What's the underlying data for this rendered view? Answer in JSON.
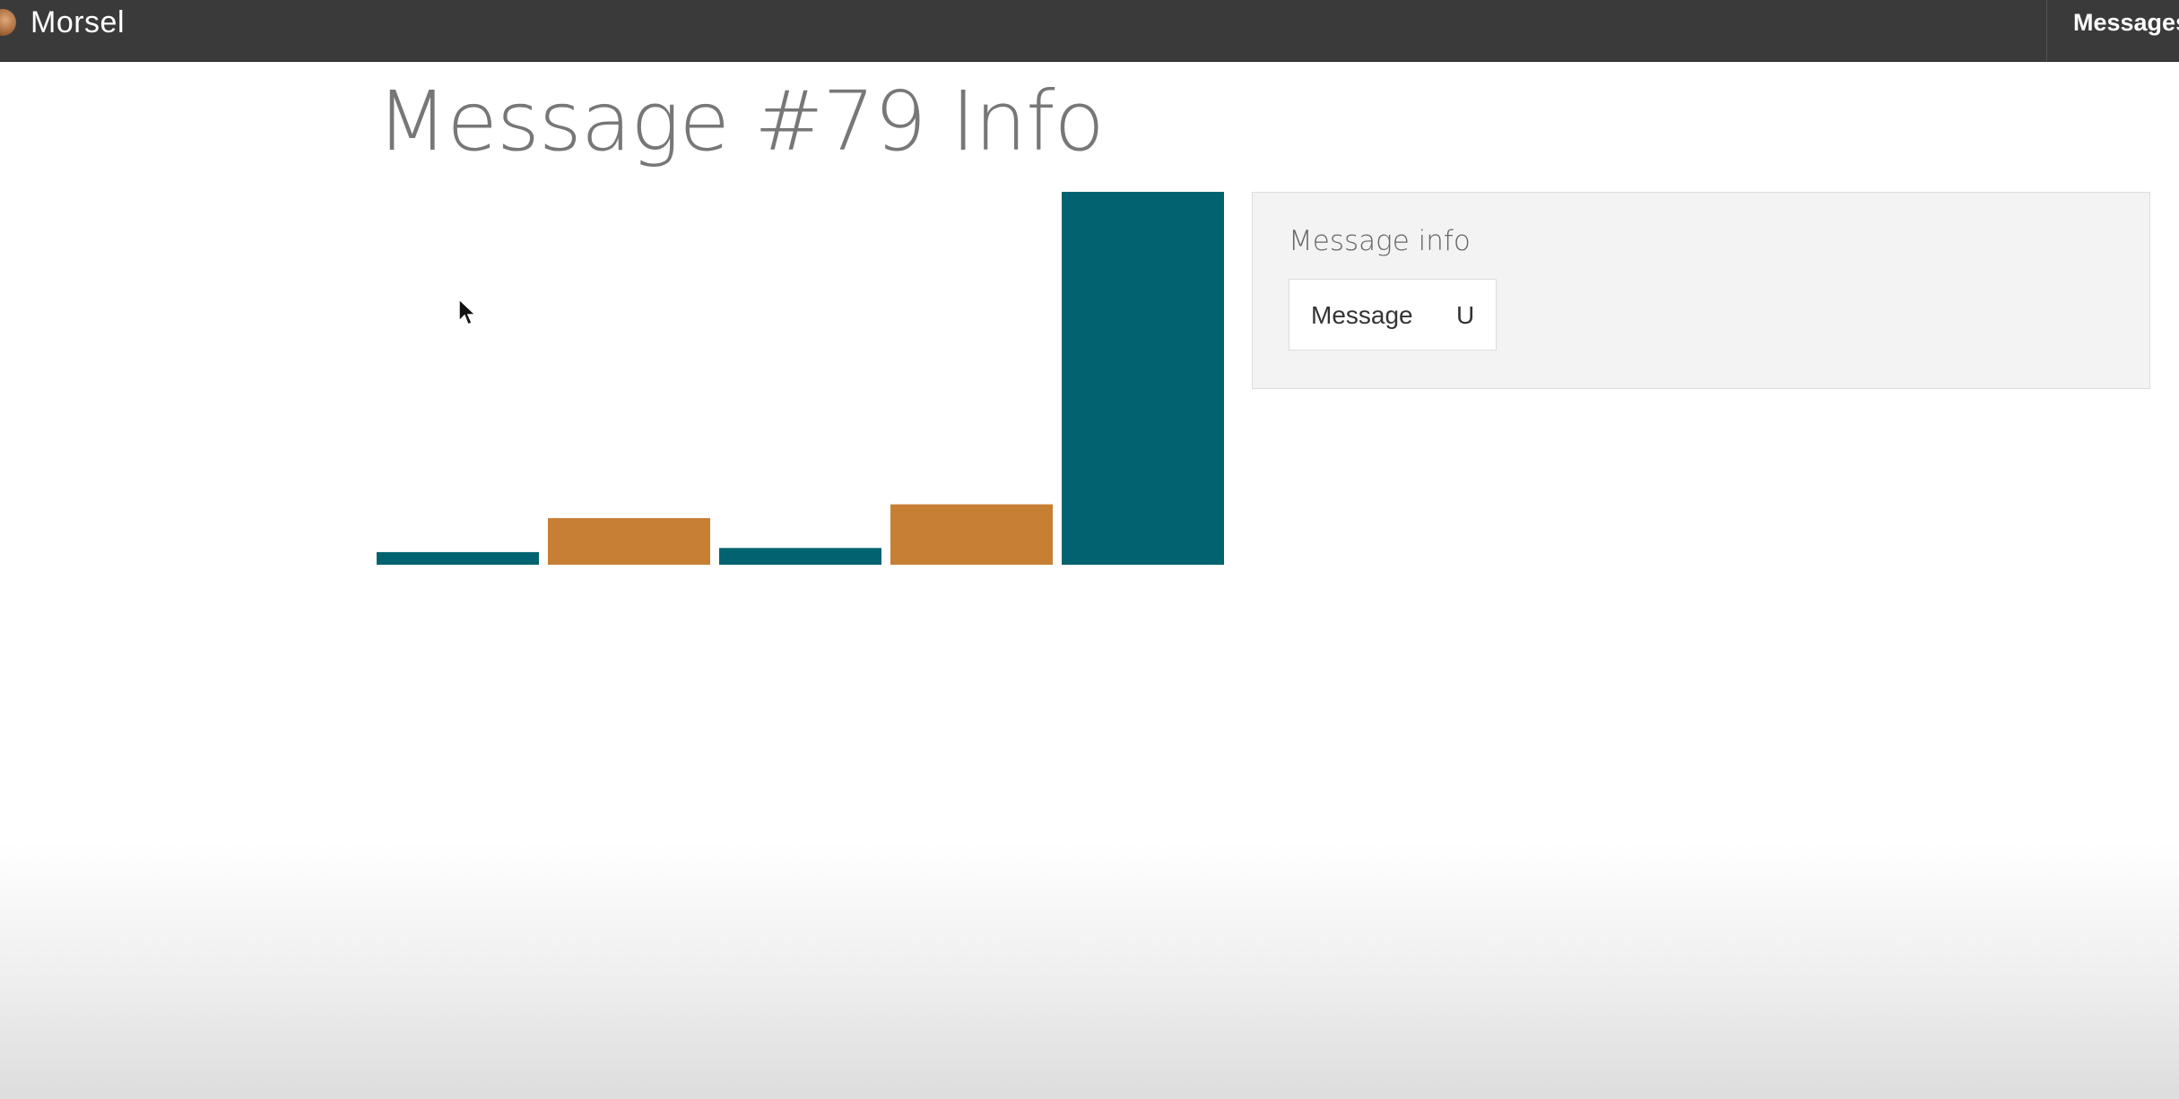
{
  "navbar": {
    "brand_name": "Morsel",
    "logo_icon": "morsel-logo-icon",
    "messages_link": "Messages"
  },
  "page": {
    "title": "Message #79 Info"
  },
  "info_panel": {
    "heading": "Message info",
    "tabs": [
      {
        "label": "Message"
      },
      {
        "label": "U"
      }
    ]
  },
  "colors": {
    "teal": "#00636f",
    "orange": "#c77f34",
    "navbar": "#3a3a3a"
  },
  "chart_data": {
    "type": "bar",
    "categories": [
      "",
      "",
      "",
      "",
      ""
    ],
    "values": [
      3.4,
      12.5,
      4.5,
      16.2,
      100
    ],
    "bar_colors": [
      "#00636f",
      "#c77f34",
      "#00636f",
      "#c77f34",
      "#00636f"
    ],
    "ylim": [
      0,
      100
    ],
    "title": "",
    "xlabel": "",
    "ylabel": "",
    "grid": false,
    "axes_visible": false
  }
}
